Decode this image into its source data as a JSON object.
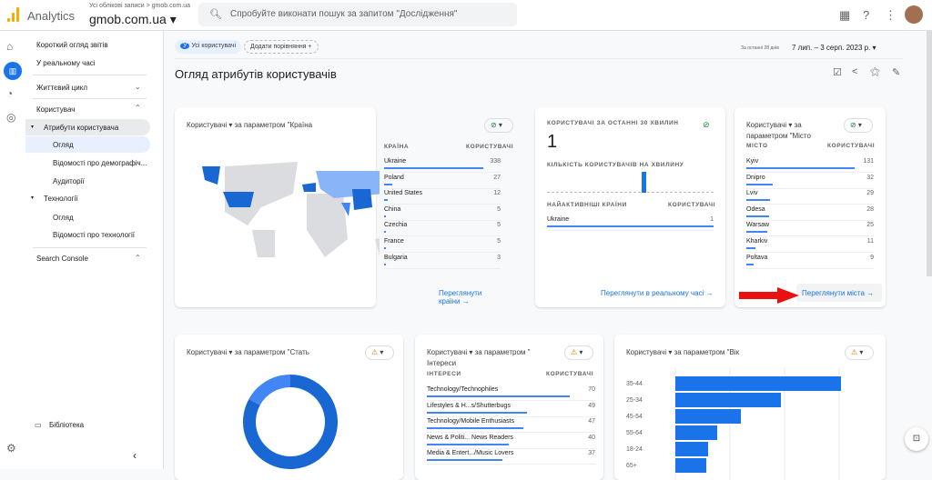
{
  "app": {
    "name": "Analytics",
    "account_crumb": "Усі облікові записи > gmob.com.ua",
    "property": "gmob.com.ua",
    "search_placeholder": "Спробуйте виконати пошук за запитом \"Дослідження\""
  },
  "colors": {
    "accent": "#1a73e8",
    "bar": "#4285f4",
    "map_dark": "#1967d2",
    "map_light": "#8ab4f8",
    "arrow": "#e8110f"
  },
  "nav": {
    "items": [
      "Короткий огляд звітів",
      "У реальному часі",
      "Життєвий цикл",
      "Користувач",
      "Атрибути користувача",
      "Огляд",
      "Відомості про демографіч...",
      "Аудиторії",
      "Технології",
      "Огляд",
      "Відомості про технології",
      "Search Console"
    ],
    "library": "Бібліотека"
  },
  "filters": {
    "segment_letter": "У",
    "segment": "Усі користувачі",
    "add_compare": "Додати порівняння",
    "date_prefix": "За останні 28 днів",
    "date_range": "7 лип. – 3 серп. 2023 р."
  },
  "page_title": "Огляд атрибутів користувачів",
  "country_card": {
    "title": "Користувачі ▾ за параметром \"Країна",
    "col1": "КРАЇНА",
    "col2": "КОРИСТУВАЧІ",
    "rows": [
      {
        "name": "Ukraine",
        "value": 338
      },
      {
        "name": "Poland",
        "value": 27
      },
      {
        "name": "United States",
        "value": 12
      },
      {
        "name": "China",
        "value": 5
      },
      {
        "name": "Czechia",
        "value": 5
      },
      {
        "name": "France",
        "value": 5
      },
      {
        "name": "Bulgaria",
        "value": 3
      }
    ],
    "link": "Переглянути країни"
  },
  "realtime_card": {
    "title": "КОРИСТУВАЧІ ЗА ОСТАННІ 30 ХВИЛИН",
    "value": "1",
    "per_minute": "КІЛЬКІСТЬ КОРИСТУВАЧІВ НА ХВИЛИНУ",
    "col1": "НАЙАКТИВНІШІ КРАЇНИ",
    "col2": "КОРИСТУВАЧІ",
    "rows": [
      {
        "name": "Ukraine",
        "value": 1
      }
    ],
    "link": "Переглянути в реальному часі"
  },
  "city_card": {
    "title": "Користувачі ▾ за параметром \"Місто",
    "col1": "МІСТО",
    "col2": "КОРИСТУВАЧІ",
    "rows": [
      {
        "name": "Kyiv",
        "value": 131
      },
      {
        "name": "Dnipro",
        "value": 32
      },
      {
        "name": "Lviv",
        "value": 29
      },
      {
        "name": "Odesa",
        "value": 28
      },
      {
        "name": "Warsaw",
        "value": 25
      },
      {
        "name": "Kharkiv",
        "value": 11
      },
      {
        "name": "Poltava",
        "value": 9
      }
    ],
    "link": "Переглянути міста"
  },
  "gender_card": {
    "title": "Користувачі ▾ за параметром \"Стать",
    "slices": [
      83,
      17
    ]
  },
  "interests_card": {
    "title": "Користувачі ▾ за параметром \" Інтереси",
    "col1": "ІНТЕРЕСИ",
    "col2": "КОРИСТУВАЧІ",
    "rows": [
      {
        "name": "Technology/Technophiles",
        "value": 70
      },
      {
        "name": "Lifestyles & H...s/Shutterbugs",
        "value": 49
      },
      {
        "name": "Technology/Mobile Enthusiasts",
        "value": 47
      },
      {
        "name": "News & Politi... News Readers",
        "value": 40
      },
      {
        "name": "Media & Entert.../Music Lovers",
        "value": 37
      }
    ]
  },
  "age_card": {
    "title": "Користувачі ▾ за параметром \"Вік",
    "categories": [
      "35-44",
      "25-34",
      "45-54",
      "55-64",
      "18-24",
      "65+"
    ],
    "values": [
      91,
      58,
      36,
      23,
      18,
      17
    ]
  }
}
